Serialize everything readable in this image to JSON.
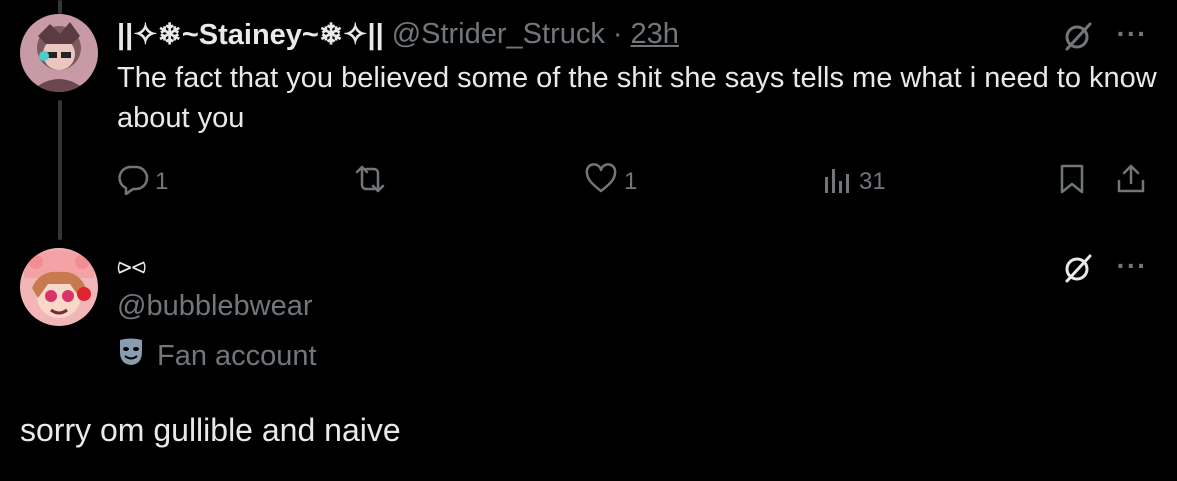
{
  "tweet1": {
    "display_name": "||✧❄~Stainey~❄✧||",
    "handle": "@Strider_Struck",
    "separator": "·",
    "time": "23h",
    "text": "The fact that you believed some of the shit she says tells me what i need to know about you",
    "stats": {
      "replies": "1",
      "likes": "1",
      "views": "31"
    }
  },
  "tweet2": {
    "display_name": "⪧⪦",
    "handle": "@bubblebwear",
    "label": "Fan account",
    "text": "sorry om gullible and naive"
  },
  "more_label": "···",
  "icons": {
    "reply": "reply-icon",
    "repost": "repost-icon",
    "like": "heart-icon",
    "views": "views-icon",
    "bookmark": "bookmark-icon",
    "share": "share-icon",
    "grok": "grok-icon",
    "mask": "theater-mask-icon"
  },
  "colors": {
    "background": "#000000",
    "text": "#e7e9ea",
    "muted": "#71767b"
  }
}
